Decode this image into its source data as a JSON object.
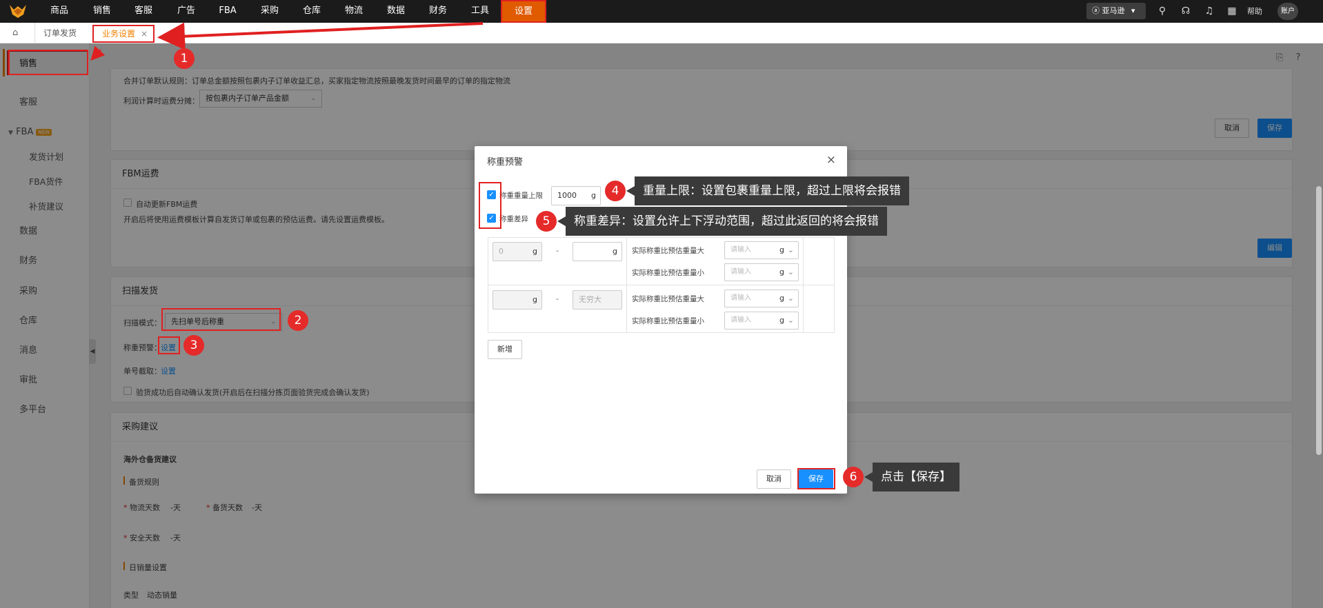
{
  "nav": {
    "items": [
      "商品",
      "销售",
      "客服",
      "广告",
      "FBA",
      "采购",
      "仓库",
      "物流",
      "数据",
      "财务",
      "工具",
      "设置"
    ],
    "store": "亚马逊",
    "help": "帮助",
    "account": "账户"
  },
  "tabs": {
    "order": "订单发货",
    "biz": "业务设置",
    "close": "×"
  },
  "sidebar": {
    "sales": "销售",
    "service": "客服",
    "fba": "FBA",
    "new_badge": "NEW",
    "fba_children": [
      "发货计划",
      "FBA货件",
      "补货建议"
    ],
    "rest": [
      "数据",
      "财务",
      "采购",
      "仓库",
      "消息",
      "审批",
      "多平台"
    ]
  },
  "merge": {
    "rule_text": "合并订单默认规则：订单总金额按照包裹内子订单收益汇总，买家指定物流按照最晚发货时间最早的订单的指定物流",
    "profit_label": "利润计算时运费分摊：",
    "profit_value": "按包裹内子订单产品金额",
    "cancel": "取消",
    "save": "保存"
  },
  "fbm": {
    "title": "FBM运费",
    "auto_label": "自动更新FBM运费",
    "desc": "开启后将使用运费模板计算自发货订单或包裹的预估运费。请先设置运费模板。",
    "edit": "编辑"
  },
  "scan": {
    "title": "扫描发货",
    "mode_label": "扫描模式：",
    "mode_value": "先扫单号后称重",
    "weight_label": "称重预警：",
    "weight_link": "设置",
    "order_label": "单号截取：",
    "order_link": "设置",
    "auto_confirm": "验货成功后自动确认发货(开启后在扫描分拣页面验货完成会确认发货)"
  },
  "purchase": {
    "title": "采购建议",
    "overseas": "海外仓备货建议",
    "rule": "备货规则",
    "logistics_days": "物流天数",
    "stock_days": "备货天数",
    "safe_days": "安全天数",
    "dash_val": "-天",
    "daily": "日销量设置",
    "type_label": "类型",
    "type_value": "动态销量"
  },
  "modal": {
    "title": "称重预警",
    "close": "×",
    "upper_label": "称重重量上限",
    "upper_value": "1000",
    "unit": "g",
    "diff_label": "称重差异",
    "row1_from": "0",
    "dash": "-",
    "placeholder": "请输入",
    "infinite": "无穷大",
    "bigger": "实际称重比预估重量大",
    "smaller": "实际称重比预估重量小",
    "add": "新增",
    "cancel": "取消",
    "save": "保存"
  },
  "annotations": {
    "steps": [
      "1",
      "2",
      "3",
      "4",
      "5",
      "6"
    ],
    "callout4": "重量上限：设置包裹重量上限，超过上限将会报错",
    "callout5": "称重差异：设置允许上下浮动范围，超过此返回的将会报错",
    "callout6": "点击【保存】"
  },
  "colors": {
    "accent": "#f08000",
    "primary": "#1890ff",
    "annotation_red": "#e02020",
    "nav_bg": "#1b1b1b"
  }
}
